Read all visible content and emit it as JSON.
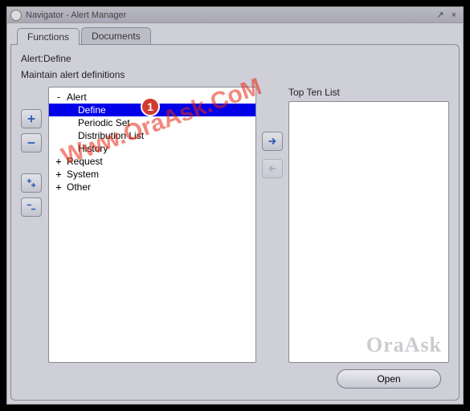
{
  "window": {
    "title": "Navigator - Alert Manager"
  },
  "tabs": {
    "functions": "Functions",
    "documents": "Documents"
  },
  "crumb": "Alert:Define",
  "subhead": "Maintain alert definitions",
  "tree": {
    "root": "Alert",
    "define": "Define",
    "periodic": "Periodic Set",
    "distlist": "Distribution List",
    "history": "History",
    "request": "Request",
    "system": "System",
    "other": "Other"
  },
  "badge": "1",
  "right": {
    "label": "Top Ten List"
  },
  "footer": {
    "open": "Open"
  },
  "watermark": "Www.OraAsk.CoM",
  "corner_mark": "OraAsk"
}
